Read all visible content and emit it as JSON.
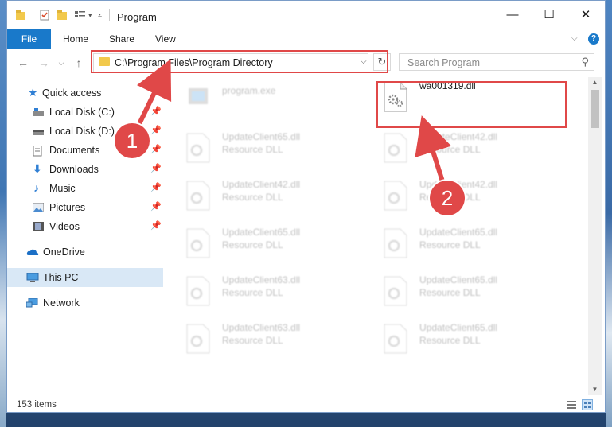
{
  "window": {
    "title": "Program",
    "controls": {
      "minimize": "—",
      "maximize": "☐",
      "close": "✕"
    }
  },
  "ribbon": {
    "file_tab": "File",
    "tabs": [
      "Home",
      "Share",
      "View"
    ],
    "help": "?"
  },
  "navigation": {
    "back": "←",
    "forward": "→",
    "up": "↑",
    "address": "C:\\Program Files\\Program Directory",
    "refresh": "↻",
    "search_placeholder": "Search Program"
  },
  "sidebar": {
    "items": [
      {
        "label": "Quick access",
        "icon": "star-icon",
        "pinned": false
      },
      {
        "label": "Local Disk (C:)",
        "icon": "drive-icon",
        "pinned": true
      },
      {
        "label": "Local Disk (D:)",
        "icon": "drive-icon",
        "pinned": true
      },
      {
        "label": "Documents",
        "icon": "documents-icon",
        "pinned": true
      },
      {
        "label": "Downloads",
        "icon": "downloads-icon",
        "pinned": true
      },
      {
        "label": "Music",
        "icon": "music-icon",
        "pinned": true
      },
      {
        "label": "Pictures",
        "icon": "pictures-icon",
        "pinned": true
      },
      {
        "label": "Videos",
        "icon": "videos-icon",
        "pinned": true
      },
      {
        "label": "OneDrive",
        "icon": "onedrive-icon",
        "pinned": false
      },
      {
        "label": "This PC",
        "icon": "computer-icon",
        "pinned": false,
        "selected": true
      },
      {
        "label": "Network",
        "icon": "network-icon",
        "pinned": false
      }
    ]
  },
  "files": [
    {
      "name": "program.exe",
      "desc": "",
      "highlighted": false
    },
    {
      "name": "wa001319.dll",
      "desc": "",
      "highlighted": true
    },
    {
      "name": "UpdateClient65.dll",
      "desc": "Resource DLL",
      "highlighted": false
    },
    {
      "name": "UpdateClient42.dll",
      "desc": "Resource DLL",
      "highlighted": false
    },
    {
      "name": "UpdateClient42.dll",
      "desc": "Resource DLL",
      "highlighted": false
    },
    {
      "name": "UpdateClient42.dll",
      "desc": "Resource DLL",
      "highlighted": false
    },
    {
      "name": "UpdateClient65.dll",
      "desc": "Resource DLL",
      "highlighted": false
    },
    {
      "name": "UpdateClient65.dll",
      "desc": "Resource DLL",
      "highlighted": false
    },
    {
      "name": "UpdateClient63.dll",
      "desc": "Resource DLL",
      "highlighted": false
    },
    {
      "name": "UpdateClient65.dll",
      "desc": "Resource DLL",
      "highlighted": false
    },
    {
      "name": "UpdateClient63.dll",
      "desc": "Resource DLL",
      "highlighted": false
    },
    {
      "name": "UpdateClient65.dll",
      "desc": "Resource DLL",
      "highlighted": false
    }
  ],
  "status": {
    "item_count": "153 items"
  },
  "annotations": [
    {
      "number": "1",
      "target": "address-bar"
    },
    {
      "number": "2",
      "target": "wa001319.dll"
    }
  ],
  "colors": {
    "accent": "#1979ca",
    "annotation": "#e04848",
    "selected_bg": "#d9e8f6"
  }
}
